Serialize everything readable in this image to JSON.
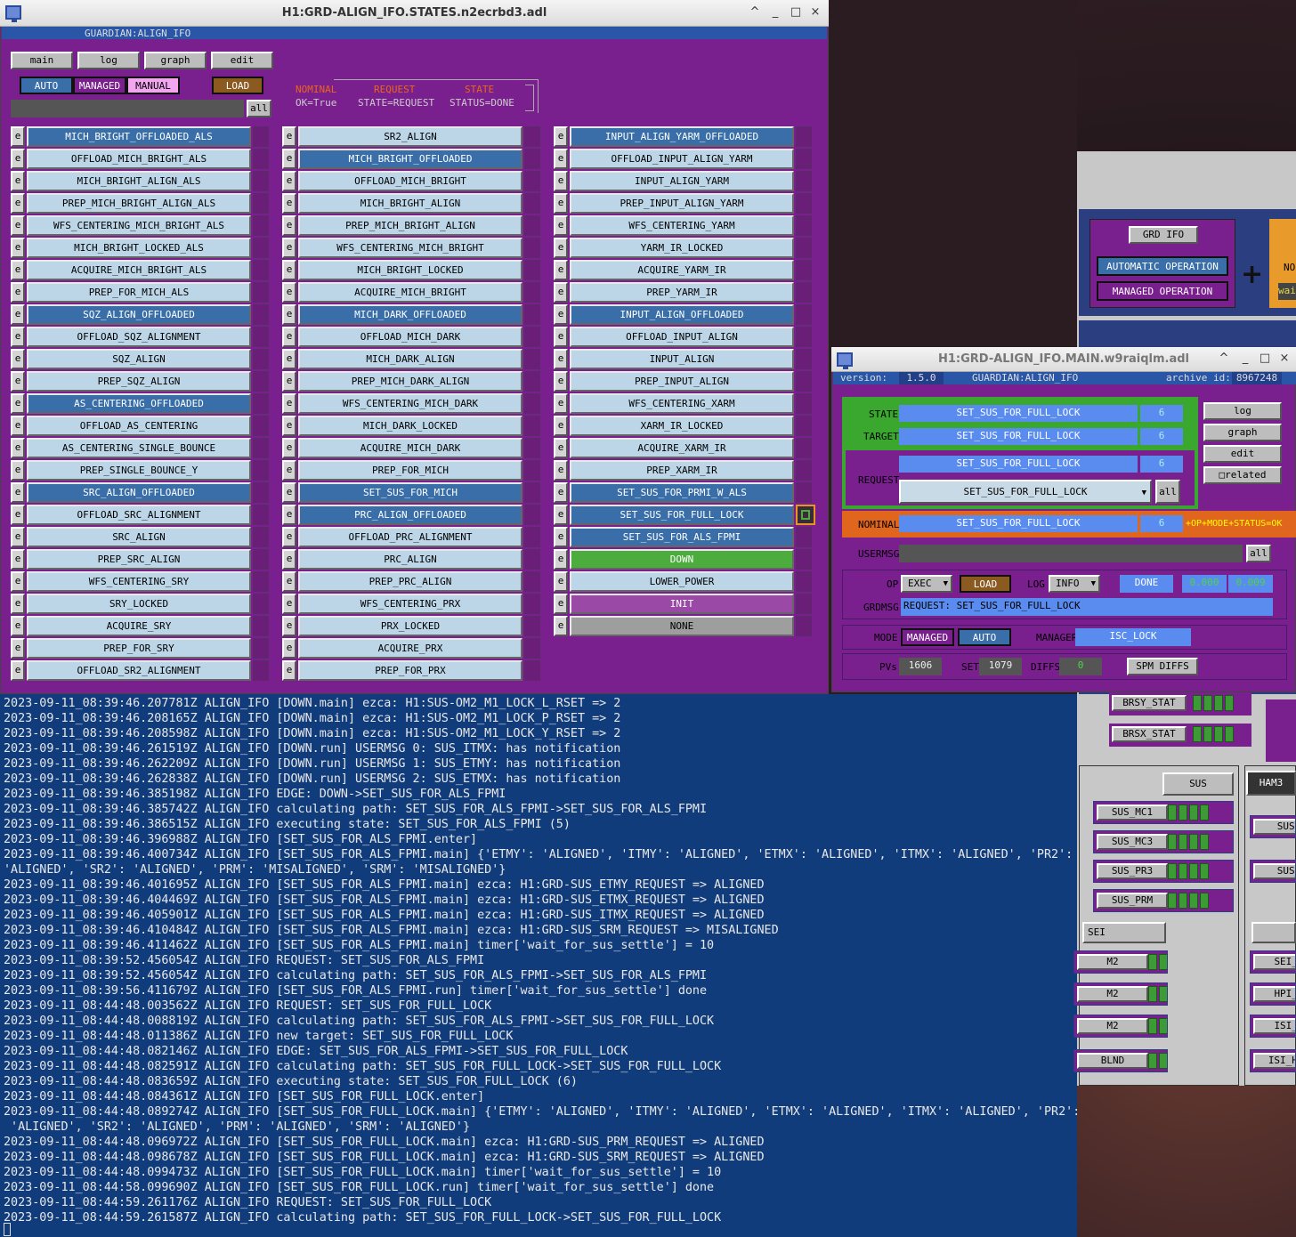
{
  "states_window": {
    "title": "H1:GRD-ALIGN_IFO.STATES.n2ecrbd3.adl",
    "guardian_label": "GUARDIAN:ALIGN_IFO",
    "tabs": [
      "main",
      "log",
      "graph",
      "edit"
    ],
    "modes": {
      "auto": "AUTO",
      "managed": "MANAGED",
      "manual": "MANUAL",
      "load": "LOAD"
    },
    "legend": {
      "nominal": "NOMINAL",
      "request": "REQUEST",
      "state": "STATE",
      "ok_true": "OK=True",
      "state_eq_request": "STATE=REQUEST",
      "status_done": "STATUS=DONE"
    },
    "all_label": "all",
    "e_label": "e",
    "col1": [
      {
        "t": "MICH_BRIGHT_OFFLOADED_ALS",
        "c": "blue"
      },
      {
        "t": "OFFLOAD_MICH_BRIGHT_ALS",
        "c": "light"
      },
      {
        "t": "MICH_BRIGHT_ALIGN_ALS",
        "c": "light"
      },
      {
        "t": "PREP_MICH_BRIGHT_ALIGN_ALS",
        "c": "light"
      },
      {
        "t": "WFS_CENTERING_MICH_BRIGHT_ALS",
        "c": "light"
      },
      {
        "t": "MICH_BRIGHT_LOCKED_ALS",
        "c": "light"
      },
      {
        "t": "ACQUIRE_MICH_BRIGHT_ALS",
        "c": "light"
      },
      {
        "t": "PREP_FOR_MICH_ALS",
        "c": "light"
      },
      {
        "t": "SQZ_ALIGN_OFFLOADED",
        "c": "blue"
      },
      {
        "t": "OFFLOAD_SQZ_ALIGNMENT",
        "c": "light"
      },
      {
        "t": "SQZ_ALIGN",
        "c": "light"
      },
      {
        "t": "PREP_SQZ_ALIGN",
        "c": "light"
      },
      {
        "t": "AS_CENTERING_OFFLOADED",
        "c": "blue"
      },
      {
        "t": "OFFLOAD_AS_CENTERING",
        "c": "light"
      },
      {
        "t": "AS_CENTERING_SINGLE_BOUNCE",
        "c": "light"
      },
      {
        "t": "PREP_SINGLE_BOUNCE_Y",
        "c": "light"
      },
      {
        "t": "SRC_ALIGN_OFFLOADED",
        "c": "blue"
      },
      {
        "t": "OFFLOAD_SRC_ALIGNMENT",
        "c": "light"
      },
      {
        "t": "SRC_ALIGN",
        "c": "light"
      },
      {
        "t": "PREP_SRC_ALIGN",
        "c": "light"
      },
      {
        "t": "WFS_CENTERING_SRY",
        "c": "light"
      },
      {
        "t": "SRY_LOCKED",
        "c": "light"
      },
      {
        "t": "ACQUIRE_SRY",
        "c": "light"
      },
      {
        "t": "PREP_FOR_SRY",
        "c": "light"
      },
      {
        "t": "OFFLOAD_SR2_ALIGNMENT",
        "c": "light"
      }
    ],
    "col2": [
      {
        "t": "SR2_ALIGN",
        "c": "light"
      },
      {
        "t": "MICH_BRIGHT_OFFLOADED",
        "c": "blue"
      },
      {
        "t": "OFFLOAD_MICH_BRIGHT",
        "c": "light"
      },
      {
        "t": "MICH_BRIGHT_ALIGN",
        "c": "light"
      },
      {
        "t": "PREP_MICH_BRIGHT_ALIGN",
        "c": "light"
      },
      {
        "t": "WFS_CENTERING_MICH_BRIGHT",
        "c": "light"
      },
      {
        "t": "MICH_BRIGHT_LOCKED",
        "c": "light"
      },
      {
        "t": "ACQUIRE_MICH_BRIGHT",
        "c": "light"
      },
      {
        "t": "MICH_DARK_OFFLOADED",
        "c": "blue"
      },
      {
        "t": "OFFLOAD_MICH_DARK",
        "c": "light"
      },
      {
        "t": "MICH_DARK_ALIGN",
        "c": "light"
      },
      {
        "t": "PREP_MICH_DARK_ALIGN",
        "c": "light"
      },
      {
        "t": "WFS_CENTERING_MICH_DARK",
        "c": "light"
      },
      {
        "t": "MICH_DARK_LOCKED",
        "c": "light"
      },
      {
        "t": "ACQUIRE_MICH_DARK",
        "c": "light"
      },
      {
        "t": "PREP_FOR_MICH",
        "c": "light"
      },
      {
        "t": "SET_SUS_FOR_MICH",
        "c": "blue"
      },
      {
        "t": "PRC_ALIGN_OFFLOADED",
        "c": "blue"
      },
      {
        "t": "OFFLOAD_PRC_ALIGNMENT",
        "c": "light"
      },
      {
        "t": "PRC_ALIGN",
        "c": "light"
      },
      {
        "t": "PREP_PRC_ALIGN",
        "c": "light"
      },
      {
        "t": "WFS_CENTERING_PRX",
        "c": "light"
      },
      {
        "t": "PRX_LOCKED",
        "c": "light"
      },
      {
        "t": "ACQUIRE_PRX",
        "c": "light"
      },
      {
        "t": "PREP_FOR_PRX",
        "c": "light"
      }
    ],
    "col3": [
      {
        "t": "INPUT_ALIGN_YARM_OFFLOADED",
        "c": "blue"
      },
      {
        "t": "OFFLOAD_INPUT_ALIGN_YARM",
        "c": "light"
      },
      {
        "t": "INPUT_ALIGN_YARM",
        "c": "light"
      },
      {
        "t": "PREP_INPUT_ALIGN_YARM",
        "c": "light"
      },
      {
        "t": "WFS_CENTERING_YARM",
        "c": "light"
      },
      {
        "t": "YARM_IR_LOCKED",
        "c": "light"
      },
      {
        "t": "ACQUIRE_YARM_IR",
        "c": "light"
      },
      {
        "t": "PREP_YARM_IR",
        "c": "light"
      },
      {
        "t": "INPUT_ALIGN_OFFLOADED",
        "c": "blue"
      },
      {
        "t": "OFFLOAD_INPUT_ALIGN",
        "c": "light"
      },
      {
        "t": "INPUT_ALIGN",
        "c": "light"
      },
      {
        "t": "PREP_INPUT_ALIGN",
        "c": "light"
      },
      {
        "t": "WFS_CENTERING_XARM",
        "c": "light"
      },
      {
        "t": "XARM_IR_LOCKED",
        "c": "light"
      },
      {
        "t": "ACQUIRE_XARM_IR",
        "c": "light"
      },
      {
        "t": "PREP_XARM_IR",
        "c": "light"
      },
      {
        "t": "SET_SUS_FOR_PRMI_W_ALS",
        "c": "blue"
      },
      {
        "t": "SET_SUS_FOR_FULL_LOCK",
        "c": "blue"
      },
      {
        "t": "SET_SUS_FOR_ALS_FPMI",
        "c": "blue"
      },
      {
        "t": "DOWN",
        "c": "green"
      },
      {
        "t": "LOWER_POWER",
        "c": "light"
      },
      {
        "t": "INIT",
        "c": "purple"
      },
      {
        "t": "NONE",
        "c": "gray"
      }
    ]
  },
  "main_window": {
    "title": "H1:GRD-ALIGN_IFO.MAIN.w9raiqlm.adl",
    "version_label": "version:",
    "version": "1.5.0",
    "guardian_label": "GUARDIAN:ALIGN_IFO",
    "archive_label": "archive id:",
    "archive_id": "8967248",
    "state_label": "STATE",
    "state_value": "SET_SUS_FOR_FULL_LOCK",
    "state_index": "6",
    "target_label": "TARGET",
    "target_value": "SET_SUS_FOR_FULL_LOCK",
    "target_index": "6",
    "request_label": "REQUEST",
    "request_value": "SET_SUS_FOR_FULL_LOCK",
    "request_index": "6",
    "request_select": "SET_SUS_FOR_FULL_LOCK",
    "nominal_label": "NOMINAL",
    "nominal_value": "SET_SUS_FOR_FULL_LOCK",
    "nominal_index": "6",
    "nominal_status": "+OP+MODE+STATUS=OK",
    "usermsg_label": "USERMSG",
    "all_label": "all",
    "op_label": "OP",
    "op_value": "EXEC",
    "load_label": "LOAD",
    "log_label": "LOG",
    "log_value": "INFO",
    "done_label": "DONE",
    "num1": "0.000",
    "num2": "0.009",
    "grdmsg_label": "GRDMSG",
    "grdmsg_value": "REQUEST: SET_SUS_FOR_FULL_LOCK",
    "mode_label": "MODE",
    "mode_managed": "MANAGED",
    "mode_auto": "AUTO",
    "manager_label": "MANAGER",
    "manager_value": "ISC_LOCK",
    "pvs_label": "PVs",
    "pvs": "1606",
    "set_label": "SET",
    "set": "1079",
    "diffs_label": "DIFFS",
    "diffs": "0",
    "spm_label": "SPM DIFFS",
    "side_buttons": [
      "log",
      "graph",
      "edit",
      "□related"
    ]
  },
  "bg_window": {
    "grd_ifo": "GRD IFO",
    "auto_op": "AUTOMATIC OPERATION",
    "managed_op": "MANAGED OPERATION",
    "no_text": "NO",
    "wai_text": "wai",
    "brsy": "BRSY_STAT",
    "brsx": "BRSX_STAT",
    "sus": "SUS",
    "ham3": "HAM3",
    "sus_mc1": "SUS_MC1",
    "sus_mc3": "SUS_MC3",
    "sus_pr3": "SUS_PR3",
    "sus_prm": "SUS_PRM",
    "sei": "SEI",
    "m2a": "M2",
    "m2b": "M2",
    "m2c": "M2",
    "blnd": "BLND",
    "sus_r1": "SUS_",
    "sus_r2": "SUS_",
    "sei_h": "SEI_H",
    "hpi_h": "HPI_H",
    "isi_h": "ISI_H",
    "isi_ham": "ISI_HAM"
  },
  "terminal_lines": [
    "2023-09-11_08:39:46.207781Z ALIGN_IFO [DOWN.main] ezca: H1:SUS-OM2_M1_LOCK_L_RSET => 2",
    "2023-09-11_08:39:46.208165Z ALIGN_IFO [DOWN.main] ezca: H1:SUS-OM2_M1_LOCK_P_RSET => 2",
    "2023-09-11_08:39:46.208598Z ALIGN_IFO [DOWN.main] ezca: H1:SUS-OM2_M1_LOCK_Y_RSET => 2",
    "2023-09-11_08:39:46.261519Z ALIGN_IFO [DOWN.run] USERMSG 0: SUS_ITMX: has notification",
    "2023-09-11_08:39:46.262209Z ALIGN_IFO [DOWN.run] USERMSG 1: SUS_ETMY: has notification",
    "2023-09-11_08:39:46.262838Z ALIGN_IFO [DOWN.run] USERMSG 2: SUS_ETMX: has notification",
    "2023-09-11_08:39:46.385198Z ALIGN_IFO EDGE: DOWN->SET_SUS_FOR_ALS_FPMI",
    "2023-09-11_08:39:46.385742Z ALIGN_IFO calculating path: SET_SUS_FOR_ALS_FPMI->SET_SUS_FOR_ALS_FPMI",
    "2023-09-11_08:39:46.386515Z ALIGN_IFO executing state: SET_SUS_FOR_ALS_FPMI (5)",
    "2023-09-11_08:39:46.396988Z ALIGN_IFO [SET_SUS_FOR_ALS_FPMI.enter]",
    "2023-09-11_08:39:46.400734Z ALIGN_IFO [SET_SUS_FOR_ALS_FPMI.main] {'ETMY': 'ALIGNED', 'ITMY': 'ALIGNED', 'ETMX': 'ALIGNED', 'ITMX': 'ALIGNED', 'PR2':",
    "'ALIGNED', 'SR2': 'ALIGNED', 'PRM': 'MISALIGNED', 'SRM': 'MISALIGNED'}",
    "2023-09-11_08:39:46.401695Z ALIGN_IFO [SET_SUS_FOR_ALS_FPMI.main] ezca: H1:GRD-SUS_ETMY_REQUEST => ALIGNED",
    "2023-09-11_08:39:46.404469Z ALIGN_IFO [SET_SUS_FOR_ALS_FPMI.main] ezca: H1:GRD-SUS_ETMX_REQUEST => ALIGNED",
    "2023-09-11_08:39:46.405901Z ALIGN_IFO [SET_SUS_FOR_ALS_FPMI.main] ezca: H1:GRD-SUS_ITMX_REQUEST => ALIGNED",
    "2023-09-11_08:39:46.410484Z ALIGN_IFO [SET_SUS_FOR_ALS_FPMI.main] ezca: H1:GRD-SUS_SRM_REQUEST => MISALIGNED",
    "2023-09-11_08:39:46.411462Z ALIGN_IFO [SET_SUS_FOR_ALS_FPMI.main] timer['wait_for_sus_settle'] = 10",
    "2023-09-11_08:39:52.456054Z ALIGN_IFO REQUEST: SET_SUS_FOR_ALS_FPMI",
    "2023-09-11_08:39:52.456054Z ALIGN_IFO calculating path: SET_SUS_FOR_ALS_FPMI->SET_SUS_FOR_ALS_FPMI",
    "2023-09-11_08:39:56.411679Z ALIGN_IFO [SET_SUS_FOR_ALS_FPMI.run] timer['wait_for_sus_settle'] done",
    "2023-09-11_08:44:48.003562Z ALIGN_IFO REQUEST: SET_SUS_FOR_FULL_LOCK",
    "2023-09-11_08:44:48.008819Z ALIGN_IFO calculating path: SET_SUS_FOR_ALS_FPMI->SET_SUS_FOR_FULL_LOCK",
    "2023-09-11_08:44:48.011386Z ALIGN_IFO new target: SET_SUS_FOR_FULL_LOCK",
    "2023-09-11_08:44:48.082146Z ALIGN_IFO EDGE: SET_SUS_FOR_ALS_FPMI->SET_SUS_FOR_FULL_LOCK",
    "2023-09-11_08:44:48.082591Z ALIGN_IFO calculating path: SET_SUS_FOR_FULL_LOCK->SET_SUS_FOR_FULL_LOCK",
    "2023-09-11_08:44:48.083659Z ALIGN_IFO executing state: SET_SUS_FOR_FULL_LOCK (6)",
    "2023-09-11_08:44:48.084361Z ALIGN_IFO [SET_SUS_FOR_FULL_LOCK.enter]",
    "2023-09-11_08:44:48.089274Z ALIGN_IFO [SET_SUS_FOR_FULL_LOCK.main] {'ETMY': 'ALIGNED', 'ITMY': 'ALIGNED', 'ETMX': 'ALIGNED', 'ITMX': 'ALIGNED', 'PR2':",
    " 'ALIGNED', 'SR2': 'ALIGNED', 'PRM': 'ALIGNED', 'SRM': 'ALIGNED'}",
    "2023-09-11_08:44:48.096972Z ALIGN_IFO [SET_SUS_FOR_FULL_LOCK.main] ezca: H1:GRD-SUS_PRM_REQUEST => ALIGNED",
    "2023-09-11_08:44:48.098678Z ALIGN_IFO [SET_SUS_FOR_FULL_LOCK.main] ezca: H1:GRD-SUS_SRM_REQUEST => ALIGNED",
    "2023-09-11_08:44:48.099473Z ALIGN_IFO [SET_SUS_FOR_FULL_LOCK.main] timer['wait_for_sus_settle'] = 10",
    "2023-09-11_08:44:58.099690Z ALIGN_IFO [SET_SUS_FOR_FULL_LOCK.run] timer['wait_for_sus_settle'] done",
    "2023-09-11_08:44:59.261176Z ALIGN_IFO REQUEST: SET_SUS_FOR_FULL_LOCK",
    "2023-09-11_08:44:59.261587Z ALIGN_IFO calculating path: SET_SUS_FOR_FULL_LOCK->SET_SUS_FOR_FULL_LOCK"
  ]
}
